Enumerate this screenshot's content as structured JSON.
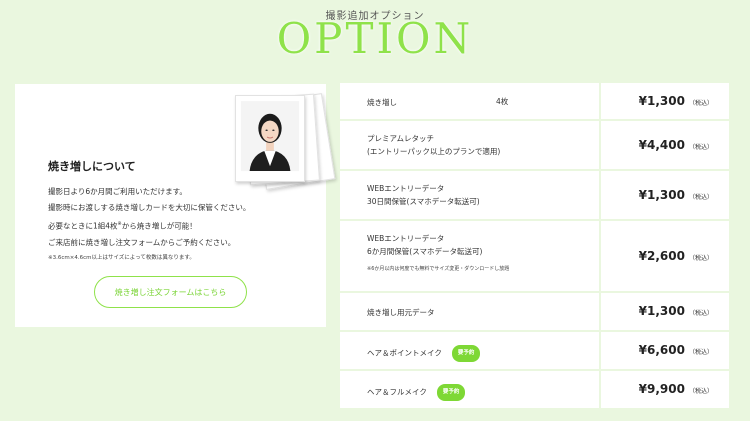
{
  "header": {
    "subtitle": "撮影追加オプション",
    "title": "OPTION"
  },
  "info_card": {
    "heading": "焼き増しについて",
    "lines": [
      "撮影日より6か月間ご利用いただけます。",
      "撮影時にお渡しする焼き増しカードを大切に保管ください。",
      "必要なときに1組4枚",
      "から焼き増しが可能！",
      "ご来店前に焼き増し注文フォームからご予約ください。"
    ],
    "superscript": "※",
    "note": "※3.6cm×4.6cm以上はサイズによって枚数は異なります。",
    "order_button": "焼き増し注文フォームはこちら"
  },
  "prices": [
    {
      "name": "焼き増し",
      "qty": "4枚",
      "price": "¥1,300",
      "tax": "（税込）"
    },
    {
      "name": "プレミアムレタッチ",
      "sub": "(エントリーパック以上のプランで適用)",
      "price": "¥4,400",
      "tax": "（税込）"
    },
    {
      "name": "WEBエントリーデータ",
      "sub": "30日間保管(スマホデータ転送可)",
      "price": "¥1,300",
      "tax": "（税込）"
    },
    {
      "name": "WEBエントリーデータ",
      "sub": "6か月間保管(スマホデータ転送可)",
      "note": "※6か月以内は何度でも無料でサイズ変更・ダウンロードし放題",
      "price": "¥2,600",
      "tax": "（税込）"
    },
    {
      "name": "焼き増し用元データ",
      "price": "¥1,300",
      "tax": "（税込）"
    },
    {
      "name": "ヘア＆ポイントメイク",
      "badge": "要予約",
      "price": "¥6,600",
      "tax": "（税込）"
    },
    {
      "name": "ヘア＆フルメイク",
      "badge": "要予約",
      "price": "¥9,900",
      "tax": "（税込）"
    }
  ],
  "colors": {
    "background": "#eaf7df",
    "accent": "#8fe24a",
    "badge": "#7ed835"
  }
}
